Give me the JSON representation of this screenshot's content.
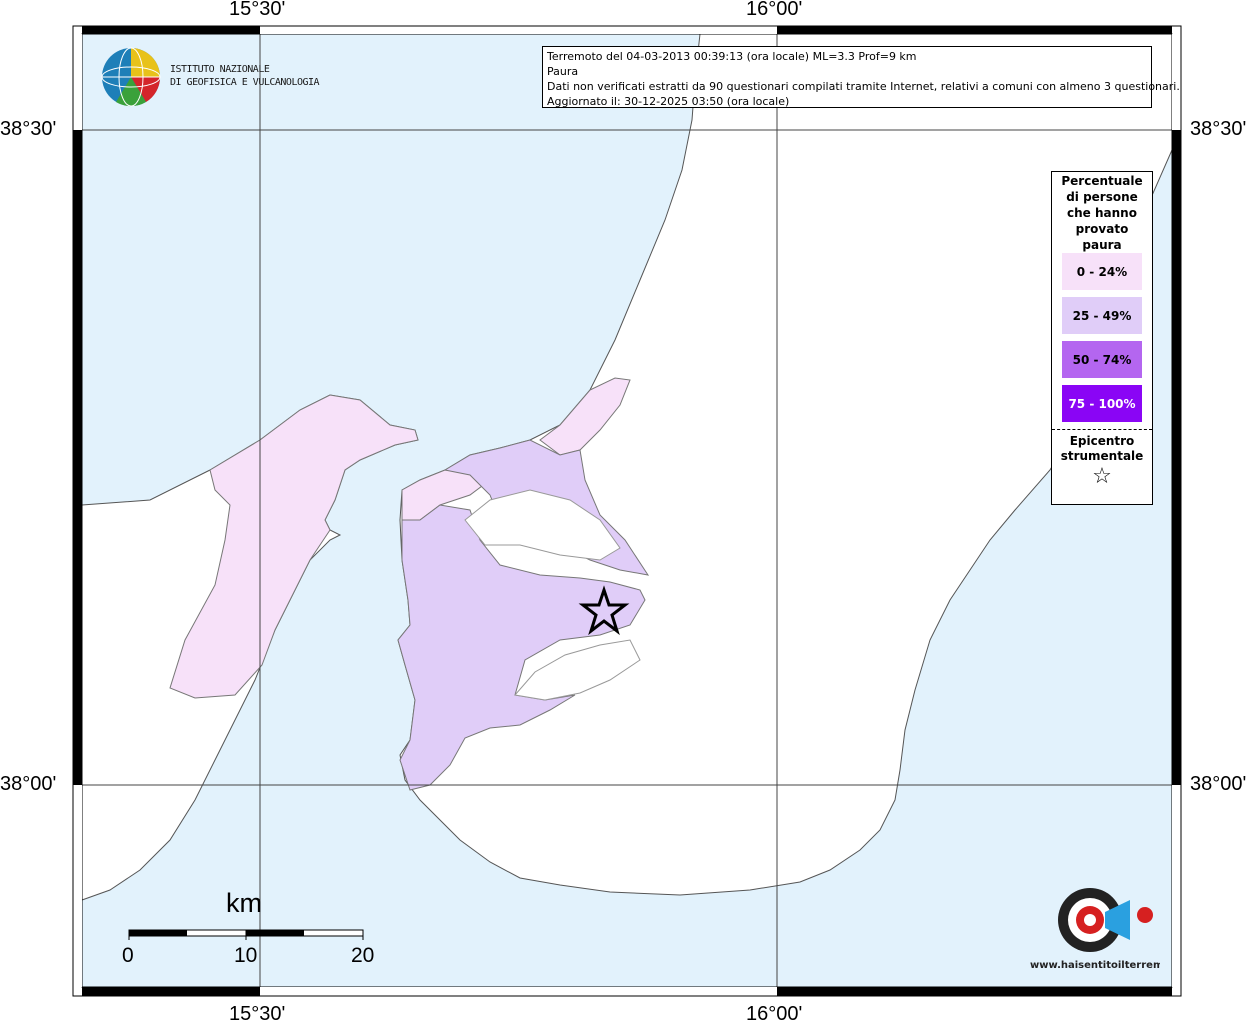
{
  "map": {
    "lon_labels_top": [
      "15°30'",
      "16°00'"
    ],
    "lon_labels_bottom": [
      "15°30'",
      "16°00'"
    ],
    "lat_labels_left": [
      "38°30'",
      "38°00'"
    ],
    "lat_labels_right": [
      "38°30'",
      "38°00'"
    ],
    "sea_color": "#e2f2fc",
    "land_color": "#ffffff",
    "border_color": "#a8a8a8"
  },
  "header": {
    "line1": "Terremoto del 04-03-2013 00:39:13 (ora locale) ML=3.3 Prof=9 km",
    "line2": "Paura",
    "line3": "Dati non verificati estratti da 90 questionari compilati tramite Internet, relativi a comuni con almeno 3 questionari.",
    "line4": "Aggiornato il: 30-12-2025 03:50 (ora locale)"
  },
  "logo": {
    "line1": "ISTITUTO NAZIONALE",
    "line2": "DI GEOFISICA E VULCANOLOGIA",
    "icon": "ingv-globe-icon"
  },
  "legend": {
    "title": "Percentuale di persone che hanno provato paura",
    "items": [
      {
        "label": "0 - 24%",
        "color": "#f7e1f9",
        "text_color": "#000000"
      },
      {
        "label": "25 - 49%",
        "color": "#e0cdf8",
        "text_color": "#000000"
      },
      {
        "label": "50 - 74%",
        "color": "#b466f0",
        "text_color": "#000000"
      },
      {
        "label": "75 - 100%",
        "color": "#8a05f5",
        "text_color": "#ffffff"
      }
    ],
    "epicenter_label": "Epicentro strumentale",
    "epicenter_symbol": "☆"
  },
  "scale": {
    "unit": "km",
    "ticks": [
      "0",
      "10",
      "20"
    ]
  },
  "watermark": {
    "text": "www.haisentitoilterremoto.it",
    "icon": "megaphone-icon"
  }
}
